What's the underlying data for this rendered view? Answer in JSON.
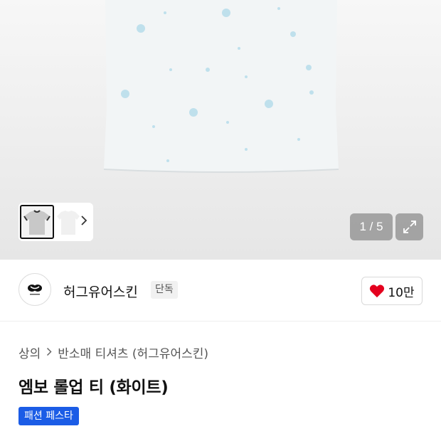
{
  "gallery": {
    "counter": "1 / 5",
    "icons": {
      "next": "chevron-right-icon",
      "expand": "expand-icon"
    }
  },
  "brand": {
    "name": "허그유어스킨",
    "tag": "단독",
    "likes": "10만",
    "like_icon": "heart-icon",
    "heart_color": "#e4001e"
  },
  "breadcrumb": {
    "root": "상의",
    "category": "반소매 티셔츠 (허그유어스킨)"
  },
  "product": {
    "title": "엠보 롤업 티 (화이트)",
    "badge": "패션 페스타",
    "badge_color": "#1b5ce6"
  }
}
